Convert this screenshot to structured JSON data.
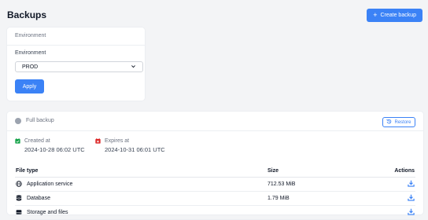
{
  "header": {
    "title": "Backups",
    "create_button": "Create backup"
  },
  "environment": {
    "card_title": "Environment",
    "field_label": "Environment",
    "selected": "PROD",
    "apply_button": "Apply"
  },
  "backup": {
    "title": "Full backup",
    "restore_button": "Restore",
    "created_label": "Created at",
    "created_value": "2024-10-28 06:02 UTC",
    "expires_label": "Expires at",
    "expires_value": "2024-10-31 06:01 UTC",
    "table": {
      "headers": [
        "File type",
        "Size",
        "Actions"
      ],
      "rows": [
        {
          "type": "Application service",
          "size": "712.53 MiB",
          "icon": "globe-icon"
        },
        {
          "type": "Database",
          "size": "1.79 MiB",
          "icon": "database-icon"
        },
        {
          "type": "Storage and files",
          "size": "",
          "icon": "storage-icon"
        }
      ]
    }
  },
  "colors": {
    "accent": "#3b82f6",
    "created_icon": "#16a34a",
    "expires_icon": "#dc2626",
    "status_dot": "#9ca3af"
  }
}
